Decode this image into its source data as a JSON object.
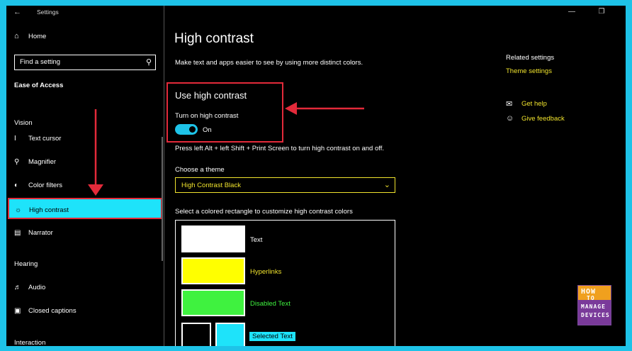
{
  "window": {
    "title": "Settings"
  },
  "sidebar": {
    "home_label": "Home",
    "search_placeholder": "Find a setting",
    "section_title": "Ease of Access",
    "groups": {
      "vision": "Vision",
      "hearing": "Hearing",
      "interaction": "Interaction"
    },
    "items": [
      {
        "label": "Text cursor",
        "icon": "text-cursor-icon"
      },
      {
        "label": "Magnifier",
        "icon": "magnifier-icon"
      },
      {
        "label": "Color filters",
        "icon": "color-filters-icon"
      },
      {
        "label": "High contrast",
        "icon": "high-contrast-icon",
        "selected": true
      },
      {
        "label": "Narrator",
        "icon": "narrator-icon"
      },
      {
        "label": "Audio",
        "icon": "speaker-icon"
      },
      {
        "label": "Closed captions",
        "icon": "captions-icon"
      }
    ]
  },
  "main": {
    "title": "High contrast",
    "description": "Make text and apps easier to see by using more distinct colors.",
    "toggle_section": {
      "heading": "Use high contrast",
      "label": "Turn on high contrast",
      "state": "On",
      "on": true
    },
    "shortcut_hint": "Press left Alt + left Shift + Print Screen to turn high contrast on and off.",
    "theme": {
      "label": "Choose a theme",
      "selected": "High Contrast Black"
    },
    "customize_label": "Select a colored rectangle to customize high contrast colors",
    "colors": [
      {
        "label": "Text",
        "swatch": "#ffffff",
        "text_color": "#ffffff"
      },
      {
        "label": "Hyperlinks",
        "swatch": "#ffff00",
        "text_color": "#f0e32d"
      },
      {
        "label": "Disabled Text",
        "swatch": "#3ff23f",
        "text_color": "#3ff23f"
      },
      {
        "label": "Selected Text",
        "swatch": "#1ee3fa",
        "text_color": "#000000"
      }
    ]
  },
  "related": {
    "title": "Related settings",
    "link": "Theme settings",
    "get_help": "Get help",
    "give_feedback": "Give feedback"
  },
  "logo": {
    "line1": "HOW",
    "line2": "TO",
    "line3": "MANAGE",
    "line4": "DEVICES"
  },
  "colors": {
    "accent": "#1ec3e8",
    "annotation": "#e32a3a",
    "link": "#f0e32d",
    "selection": "#1ee3fa"
  }
}
